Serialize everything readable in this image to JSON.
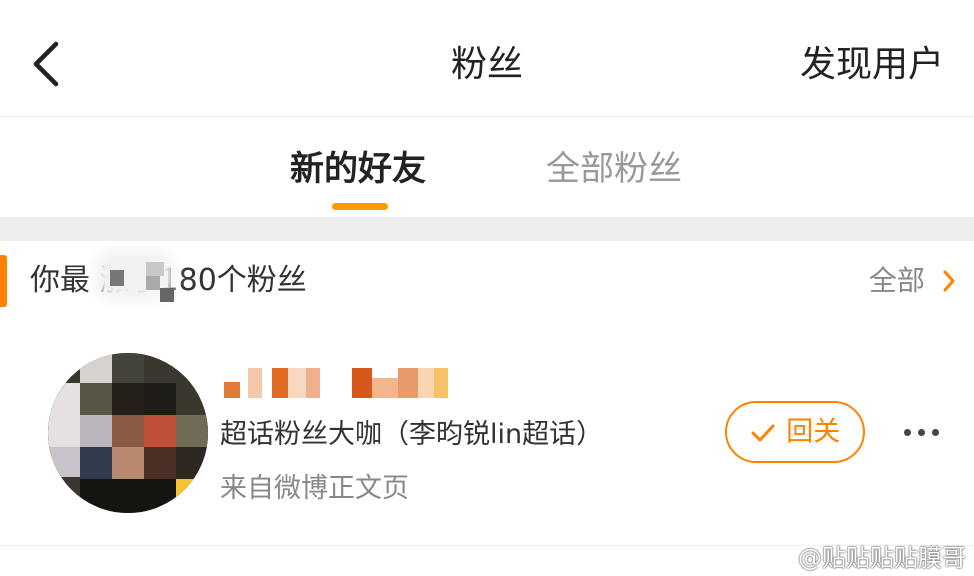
{
  "header": {
    "title": "粉丝",
    "discover_label": "发现用户"
  },
  "tabs": [
    {
      "label": "新的好友",
      "active": true
    },
    {
      "label": "全部粉丝",
      "active": false
    }
  ],
  "colors": {
    "accent": "#ff8200",
    "indicator": "#ff9a00",
    "muted": "#999999"
  },
  "section": {
    "text": "你最  涨了180个粉丝",
    "see_all_label": "全部"
  },
  "users": [
    {
      "badge": "超话粉丝大咖（李昀锐lin超话）",
      "source": "来自微博正文页",
      "follow_back_label": "回关"
    }
  ],
  "watermark": {
    "text": "@贴贴贴贴膜哥"
  },
  "icons": {
    "back": "chevron-left-icon",
    "see_all": "chevron-right-icon",
    "check": "check-icon",
    "more": "more-horizontal-icon",
    "watermark": "weibo-logo-icon"
  }
}
